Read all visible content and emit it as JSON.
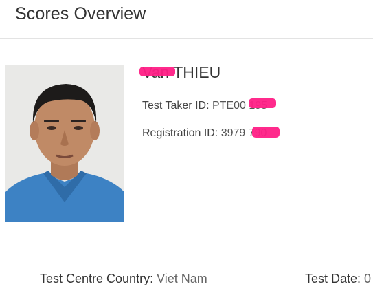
{
  "header": {
    "title": "Scores Overview"
  },
  "candidate": {
    "name": "Van THIEU",
    "test_taker_id_label": "Test Taker ID: ",
    "test_taker_id_value": "PTE00 195",
    "registration_id_label": "Registration ID: ",
    "registration_id_value": "3979 790"
  },
  "details": {
    "country_label": "Test Centre Country:",
    "country_value": " Viet Nam",
    "date_label": "Test Date:",
    "date_value": " 0"
  },
  "colors": {
    "redaction": "#ff1f86",
    "divider": "#e3e3e3"
  }
}
